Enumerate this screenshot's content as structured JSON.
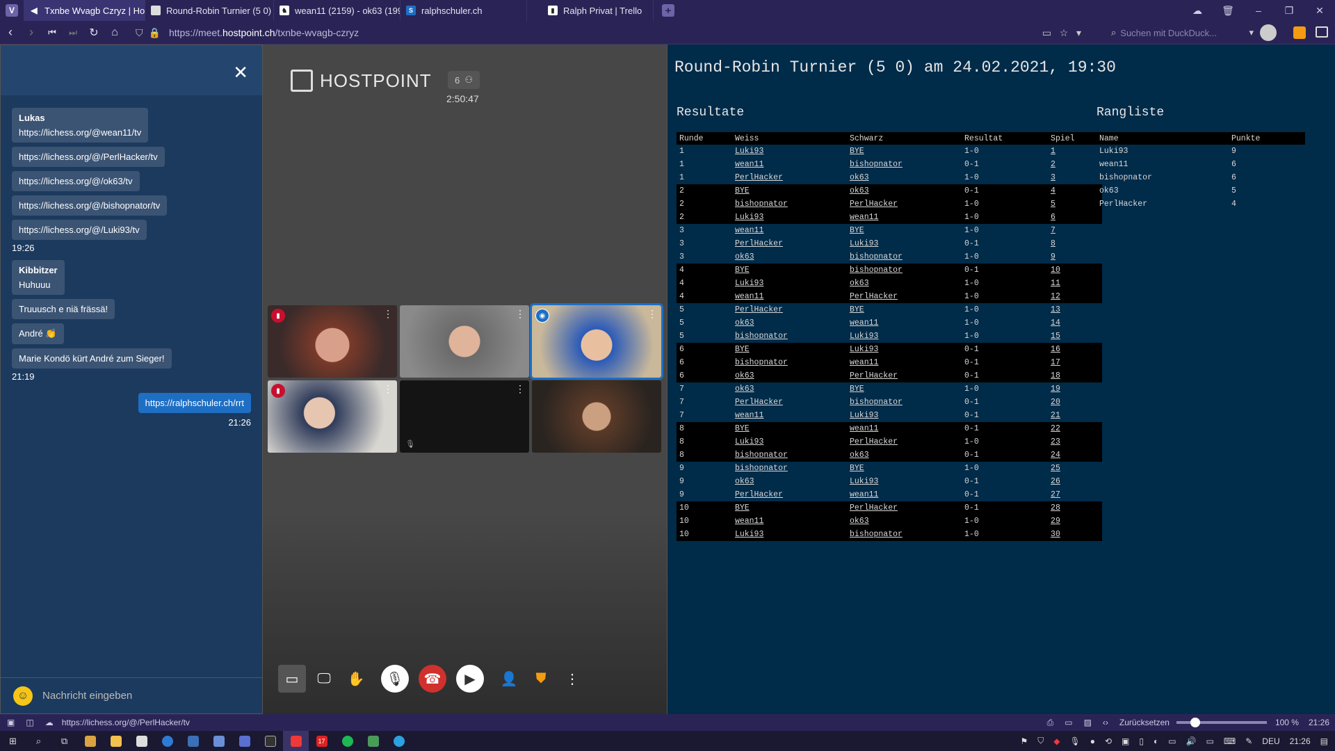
{
  "tabs": [
    {
      "label": "Txnbe Wvagb Czryz | Hostp",
      "active": true,
      "icon": "speaker-icon"
    },
    {
      "label": "Round-Robin Turnier (5 0)",
      "active": false,
      "icon": "tab-favicon"
    },
    {
      "label": "wean11 (2159) - ok63 (199",
      "active": false,
      "icon": "lichess-icon"
    },
    {
      "label": "ralphschuler.ch",
      "active": false,
      "icon": "rs-favicon"
    },
    {
      "label": "Ralph Privat | Trello",
      "active": false,
      "icon": "trello-icon"
    }
  ],
  "address": {
    "prefix": "https://meet.",
    "host": "hostpoint.ch",
    "path": "/txnbe-wvagb-czryz"
  },
  "search_placeholder": "Suchen mit DuckDuck...",
  "chat": {
    "messages": [
      {
        "sender": "Lukas",
        "lines": [
          "https://lichess.org/@wean11/tv"
        ]
      },
      {
        "sender": "",
        "lines": [
          "https://lichess.org/@/PerlHacker/tv"
        ]
      },
      {
        "sender": "",
        "lines": [
          "https://lichess.org/@/ok63/tv"
        ]
      },
      {
        "sender": "",
        "lines": [
          "https://lichess.org/@/bishopnator/tv"
        ]
      },
      {
        "sender": "",
        "lines": [
          "https://lichess.org/@/Luki93/tv"
        ]
      }
    ],
    "time1": "19:26",
    "messages2": [
      {
        "sender": "Kibbitzer",
        "lines": [
          "Huhuuu"
        ]
      },
      {
        "sender": "",
        "lines": [
          "Truuusch e niä frässä!"
        ]
      },
      {
        "sender": "",
        "lines": [
          "André 👏"
        ]
      },
      {
        "sender": "",
        "lines": [
          "Marie Kondö kürt André zum Sieger!"
        ]
      }
    ],
    "time2": "21:19",
    "own_message": "https://ralphschuler.ch/rrt",
    "own_time": "21:26",
    "input_placeholder": "Nachricht eingeben"
  },
  "video": {
    "brand": "HOSTPOINT",
    "participants": "6",
    "elapsed": "2:50:47"
  },
  "tournament": {
    "title": "Round-Robin Turnier (5 0) am 24.02.2021, 19:30",
    "results_heading": "Resultate",
    "ranking_heading": "Rangliste",
    "results_headers": [
      "Runde",
      "Weiss",
      "Schwarz",
      "Resultat",
      "Spiel"
    ],
    "results": [
      [
        "1",
        "Luki93",
        "BYE",
        "1-0",
        "1"
      ],
      [
        "1",
        "wean11",
        "bishopnator",
        "0-1",
        "2"
      ],
      [
        "1",
        "PerlHacker",
        "ok63",
        "1-0",
        "3"
      ],
      [
        "2",
        "BYE",
        "ok63",
        "0-1",
        "4"
      ],
      [
        "2",
        "bishopnator",
        "PerlHacker",
        "1-0",
        "5"
      ],
      [
        "2",
        "Luki93",
        "wean11",
        "1-0",
        "6"
      ],
      [
        "3",
        "wean11",
        "BYE",
        "1-0",
        "7"
      ],
      [
        "3",
        "PerlHacker",
        "Luki93",
        "0-1",
        "8"
      ],
      [
        "3",
        "ok63",
        "bishopnator",
        "1-0",
        "9"
      ],
      [
        "4",
        "BYE",
        "bishopnator",
        "0-1",
        "10"
      ],
      [
        "4",
        "Luki93",
        "ok63",
        "1-0",
        "11"
      ],
      [
        "4",
        "wean11",
        "PerlHacker",
        "1-0",
        "12"
      ],
      [
        "5",
        "PerlHacker",
        "BYE",
        "1-0",
        "13"
      ],
      [
        "5",
        "ok63",
        "wean11",
        "1-0",
        "14"
      ],
      [
        "5",
        "bishopnator",
        "Luki93",
        "1-0",
        "15"
      ],
      [
        "6",
        "BYE",
        "Luki93",
        "0-1",
        "16"
      ],
      [
        "6",
        "bishopnator",
        "wean11",
        "0-1",
        "17"
      ],
      [
        "6",
        "ok63",
        "PerlHacker",
        "0-1",
        "18"
      ],
      [
        "7",
        "ok63",
        "BYE",
        "1-0",
        "19"
      ],
      [
        "7",
        "PerlHacker",
        "bishopnator",
        "0-1",
        "20"
      ],
      [
        "7",
        "wean11",
        "Luki93",
        "0-1",
        "21"
      ],
      [
        "8",
        "BYE",
        "wean11",
        "0-1",
        "22"
      ],
      [
        "8",
        "Luki93",
        "PerlHacker",
        "1-0",
        "23"
      ],
      [
        "8",
        "bishopnator",
        "ok63",
        "0-1",
        "24"
      ],
      [
        "9",
        "bishopnator",
        "BYE",
        "1-0",
        "25"
      ],
      [
        "9",
        "ok63",
        "Luki93",
        "0-1",
        "26"
      ],
      [
        "9",
        "PerlHacker",
        "wean11",
        "0-1",
        "27"
      ],
      [
        "10",
        "BYE",
        "PerlHacker",
        "0-1",
        "28"
      ],
      [
        "10",
        "wean11",
        "ok63",
        "1-0",
        "29"
      ],
      [
        "10",
        "Luki93",
        "bishopnator",
        "1-0",
        "30"
      ]
    ],
    "ranking_headers": [
      "Name",
      "Punkte"
    ],
    "ranking": [
      [
        "Luki93",
        "9"
      ],
      [
        "wean11",
        "6"
      ],
      [
        "bishopnator",
        "6"
      ],
      [
        "ok63",
        "5"
      ],
      [
        "PerlHacker",
        "4"
      ]
    ]
  },
  "status": {
    "link": "https://lichess.org/@/PerlHacker/tv",
    "reset": "Zurücksetzen",
    "zoom": "100 %",
    "time": "21:26"
  },
  "taskbar": {
    "lang": "DEU",
    "time": "21:26",
    "badge": "17"
  }
}
